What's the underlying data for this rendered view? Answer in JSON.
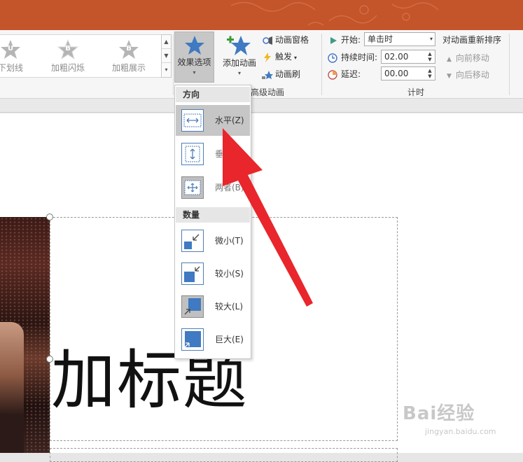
{
  "ribbon": {
    "gallery": [
      {
        "glyph": "U",
        "label": "下划线"
      },
      {
        "glyph": "B",
        "label": "加粗闪烁"
      },
      {
        "glyph": "B",
        "label": "加粗展示"
      }
    ],
    "effect_options": "效果选项",
    "add_animation": "添加动画",
    "animation_pane": "动画窗格",
    "trigger": "触发",
    "animation_painter": "动画刷",
    "advanced_group": "高级动画",
    "start_label": "开始:",
    "start_value": "单击时",
    "duration_label": "持续时间:",
    "duration_value": "02.00",
    "delay_label": "延迟:",
    "delay_value": "00.00",
    "timing_group": "计时",
    "reorder_title": "对动画重新排序",
    "move_earlier": "向前移动",
    "move_later": "向后移动"
  },
  "menu": {
    "direction_header": "方向",
    "direction_items": [
      {
        "label": "水平(Z)",
        "icon": "horizontal-arrows-icon",
        "highlighted": true
      },
      {
        "label": "垂直(V)",
        "icon": "vertical-arrows-icon",
        "highlighted": false
      },
      {
        "label": "两者(B)",
        "icon": "both-arrows-icon",
        "highlighted": false,
        "selected": true
      }
    ],
    "amount_header": "数量",
    "amount_items": [
      {
        "label": "微小(T)",
        "icon": "tiny-icon"
      },
      {
        "label": "较小(S)",
        "icon": "smaller-icon"
      },
      {
        "label": "较大(L)",
        "icon": "larger-icon",
        "selected": true
      },
      {
        "label": "巨大(E)",
        "icon": "huge-icon"
      }
    ]
  },
  "slide": {
    "title": "加标题"
  },
  "watermark": {
    "text": "Bai经验",
    "sub": "jingyan.baidu.com"
  },
  "colors": {
    "accent": "#c4542a",
    "star": "#3f7ac2",
    "arrow": "#e8262c"
  }
}
